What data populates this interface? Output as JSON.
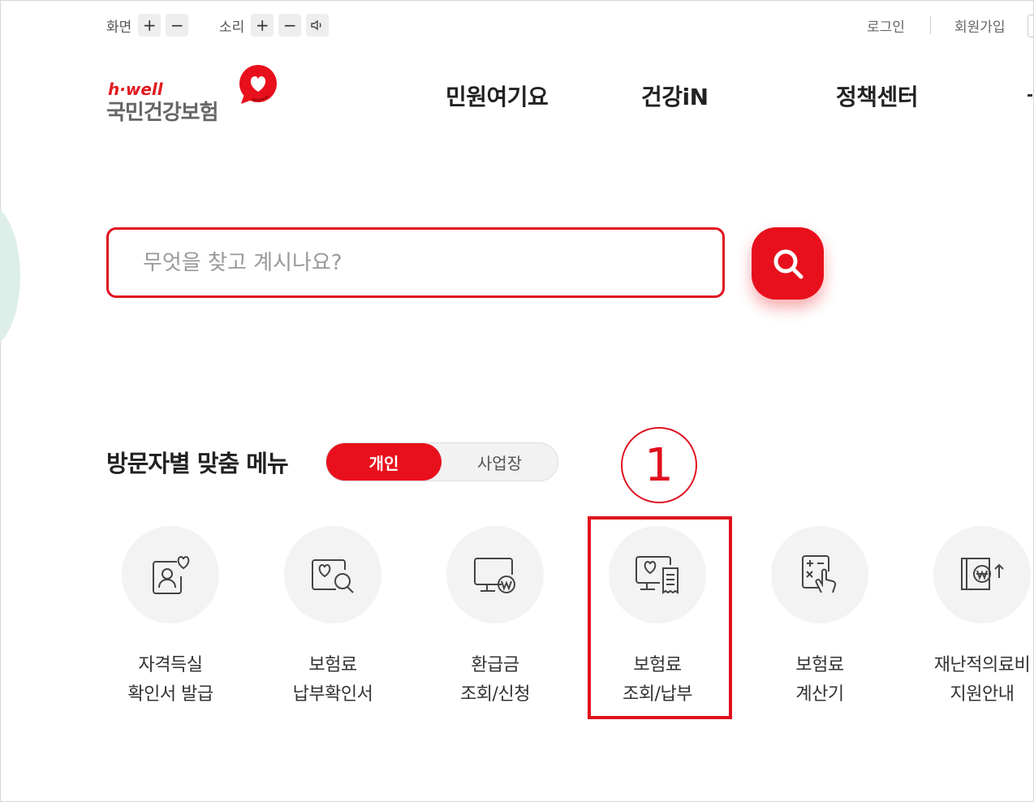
{
  "utility": {
    "screen_label": "화면",
    "sound_label": "소리",
    "plus": "+",
    "minus": "−",
    "login": "로그인",
    "signup": "회원가입"
  },
  "logo": {
    "en": "h·well",
    "ko": "국민건강보험"
  },
  "nav": [
    "민원여기요",
    "건강iN",
    "정책센터"
  ],
  "search": {
    "placeholder": "무엇을 찾고 계시나요?"
  },
  "visitor_menu": {
    "title": "방문자별 맞춤 메뉴",
    "toggle": {
      "active": "개인",
      "inactive": "사업장"
    },
    "items": [
      {
        "icon": "id-person-heart-icon",
        "line1": "자격득실",
        "line2": "확인서 발급"
      },
      {
        "icon": "heart-card-search-icon",
        "line1": "보험료",
        "line2": "납부확인서"
      },
      {
        "icon": "monitor-won-icon",
        "line1": "환급금",
        "line2": "조회/신청"
      },
      {
        "icon": "monitor-heart-receipt-icon",
        "line1": "보험료",
        "line2": "조회/납부"
      },
      {
        "icon": "calculator-hand-icon",
        "line1": "보험료",
        "line2": "계산기"
      },
      {
        "icon": "book-won-up-icon",
        "line1": "재난적의료비",
        "line2": "지원안내"
      }
    ]
  },
  "annotation": {
    "step": "1"
  },
  "colors": {
    "accent": "#e8101c",
    "logo_gray": "#666666",
    "icon_bg": "#f3f3f3"
  }
}
